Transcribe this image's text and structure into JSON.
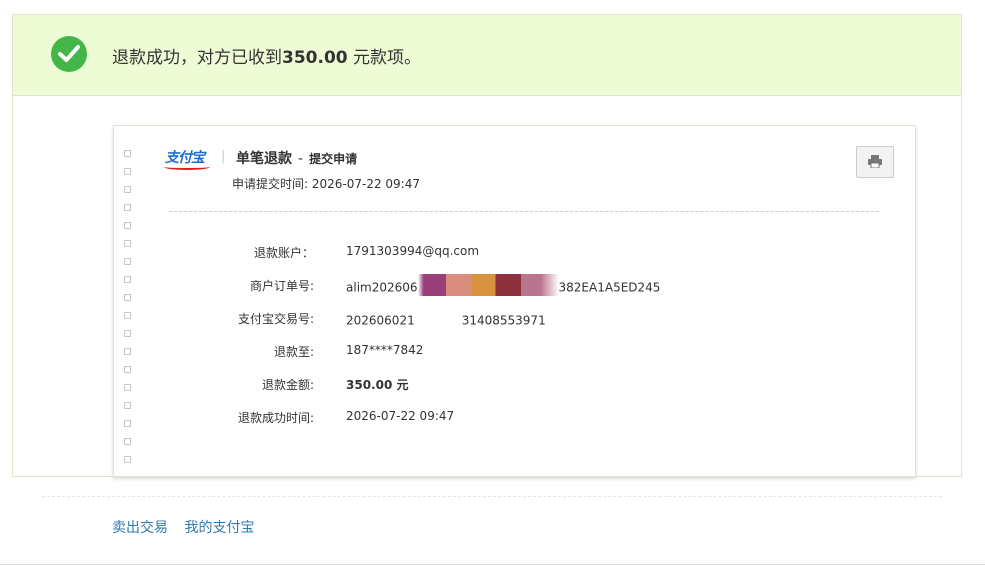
{
  "banner": {
    "prefix": "退款成功，对方已收到",
    "amount": "350.00",
    "suffix": " 元款项。",
    "status_color": "#44b549",
    "icon": "check-circle-icon"
  },
  "card": {
    "logo": "支付宝",
    "title": "单笔退款",
    "dash": "-",
    "subtitle": "提交申请",
    "apply_time": "申请提交时间: 2026-07-22 09:47",
    "print_icon": "printer-icon"
  },
  "details": [
    {
      "label": "退款账户：",
      "value": "1791303994@qq.com"
    },
    {
      "label": "商户订单号:",
      "value_prefix": "alim202606",
      "value_suffix": "382EA1A5ED245"
    },
    {
      "label": "支付宝交易号:",
      "value_prefix": "202606021",
      "value_suffix": "31408553971"
    },
    {
      "label": "退款至:",
      "value": "187****7842"
    },
    {
      "label": "退款金额:",
      "value": "350.00 元"
    },
    {
      "label": "退款成功时间:",
      "value": "2026-07-22 09:47"
    }
  ],
  "footer": {
    "link1": "卖出交易",
    "link2": "我的支付宝"
  }
}
